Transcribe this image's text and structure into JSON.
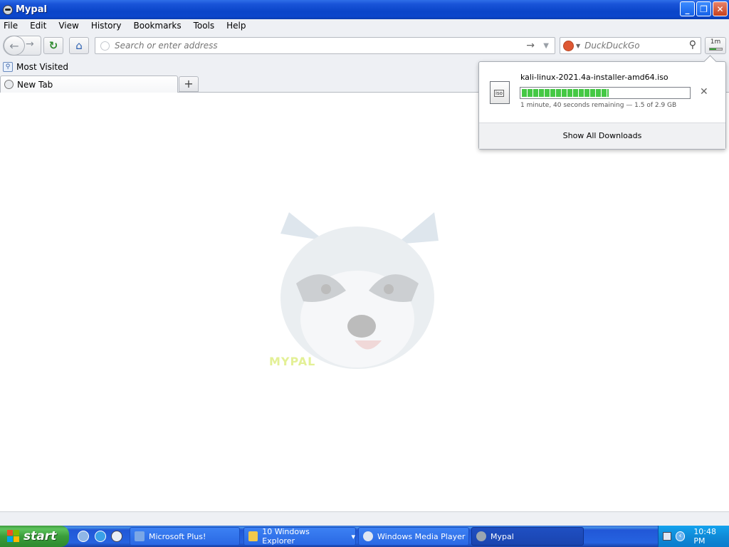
{
  "window": {
    "title": "Mypal",
    "controls": {
      "minimize": "_",
      "maximize": "❐",
      "close": "✕"
    }
  },
  "menu": [
    "File",
    "Edit",
    "View",
    "History",
    "Bookmarks",
    "Tools",
    "Help"
  ],
  "toolbar": {
    "back": "←",
    "forward": "→",
    "reload": "↻",
    "home": "⌂",
    "url_placeholder": "Search or enter address",
    "go": "→",
    "url_dropdown": "▼",
    "search_engine_dropdown": "▼",
    "search_placeholder": "DuckDuckGo",
    "search_go": "⚲",
    "download_indicator": "1m",
    "download_progress": 0.52
  },
  "bookmarks": {
    "most_visited": "Most Visited"
  },
  "tabs": [
    {
      "label": "New Tab"
    }
  ],
  "newtab_label": "+",
  "content": {
    "logo_text": "MYPAL"
  },
  "downloads": {
    "filename": "kali-linux-2021.4a-installer-amd64.iso",
    "progress": 0.52,
    "status": "1 minute, 40 seconds remaining — 1.5 of 2.9 GB",
    "cancel": "✕",
    "show_all": "Show All Downloads"
  },
  "taskbar": {
    "start": "start",
    "tasks": [
      {
        "label": "Microsoft Plus!"
      },
      {
        "label": "10 Windows Explorer",
        "dropdown": "▾"
      },
      {
        "label": "Windows Media Player"
      },
      {
        "label": "Mypal"
      }
    ],
    "tray_arrow": "‹",
    "clock": "10:48 PM"
  },
  "colors": {
    "titlebar": "#0a45c9",
    "start_green": "#3a9d3a",
    "progress_green": "#45c845",
    "tray": "#0f8bd8"
  }
}
